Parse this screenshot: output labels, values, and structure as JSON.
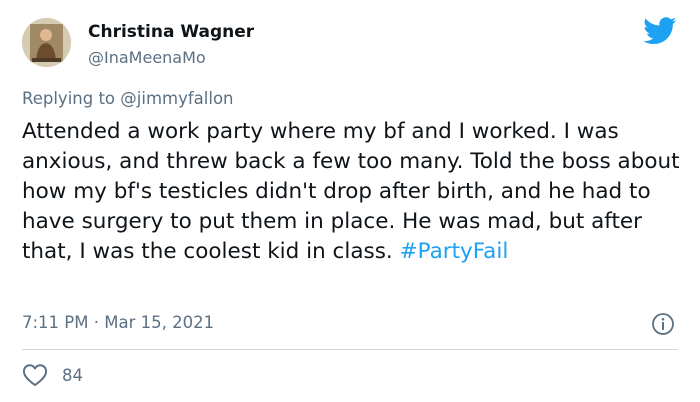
{
  "author": {
    "name": "Christina Wagner",
    "handle": "@InaMeenaMo"
  },
  "reply": {
    "prefix": "Replying to ",
    "mention": "@jimmyfallon"
  },
  "tweet": {
    "text": "Attended a work party where my bf and I worked. I was anxious, and threw back a few too many. Told the boss about how my bf's testicles didn't drop after birth, and he had to have surgery to put them in place. He was mad, but after that, I was the coolest kid in class. ",
    "hashtag": "#PartyFail",
    "time": "7:11 PM",
    "separator": " · ",
    "date": "Mar 15, 2021"
  },
  "stats": {
    "likes": "84"
  },
  "icons": {
    "brand": "twitter-bird-icon",
    "info": "info-icon",
    "like": "heart-icon"
  },
  "colors": {
    "brand": "#1da1f2",
    "text": "#0f1419",
    "secondary": "#5b7083",
    "divider": "#cfd9de"
  }
}
